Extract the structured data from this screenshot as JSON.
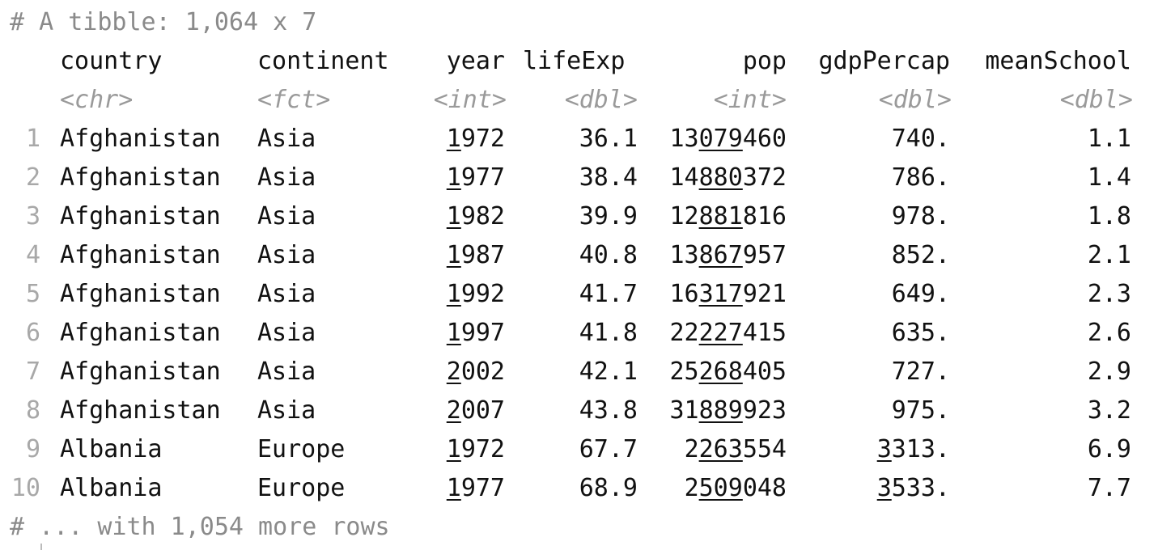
{
  "header_comment": "# A tibble: 1,064 x 7",
  "footer_comment": "# ... with 1,054 more rows",
  "columns": [
    {
      "name": "country",
      "type": "<chr>"
    },
    {
      "name": "continent",
      "type": "<fct>"
    },
    {
      "name": "year",
      "type": "<int>"
    },
    {
      "name": "lifeExp",
      "type": "<dbl>"
    },
    {
      "name": "pop",
      "type": "<int>"
    },
    {
      "name": "gdpPercap",
      "type": "<dbl>"
    },
    {
      "name": "meanSchool",
      "type": "<dbl>"
    }
  ],
  "rows": [
    {
      "idx": "1",
      "country": "Afghanistan",
      "continent": "Asia",
      "year": [
        "1",
        "972"
      ],
      "lifeExp": "36.1",
      "pop": [
        "13",
        "079",
        "460"
      ],
      "gdpPercap": [
        "",
        "740."
      ],
      "meanSchool": "1.1"
    },
    {
      "idx": "2",
      "country": "Afghanistan",
      "continent": "Asia",
      "year": [
        "1",
        "977"
      ],
      "lifeExp": "38.4",
      "pop": [
        "14",
        "880",
        "372"
      ],
      "gdpPercap": [
        "",
        "786."
      ],
      "meanSchool": "1.4"
    },
    {
      "idx": "3",
      "country": "Afghanistan",
      "continent": "Asia",
      "year": [
        "1",
        "982"
      ],
      "lifeExp": "39.9",
      "pop": [
        "12",
        "881",
        "816"
      ],
      "gdpPercap": [
        "",
        "978."
      ],
      "meanSchool": "1.8"
    },
    {
      "idx": "4",
      "country": "Afghanistan",
      "continent": "Asia",
      "year": [
        "1",
        "987"
      ],
      "lifeExp": "40.8",
      "pop": [
        "13",
        "867",
        "957"
      ],
      "gdpPercap": [
        "",
        "852."
      ],
      "meanSchool": "2.1"
    },
    {
      "idx": "5",
      "country": "Afghanistan",
      "continent": "Asia",
      "year": [
        "1",
        "992"
      ],
      "lifeExp": "41.7",
      "pop": [
        "16",
        "317",
        "921"
      ],
      "gdpPercap": [
        "",
        "649."
      ],
      "meanSchool": "2.3"
    },
    {
      "idx": "6",
      "country": "Afghanistan",
      "continent": "Asia",
      "year": [
        "1",
        "997"
      ],
      "lifeExp": "41.8",
      "pop": [
        "22",
        "227",
        "415"
      ],
      "gdpPercap": [
        "",
        "635."
      ],
      "meanSchool": "2.6"
    },
    {
      "idx": "7",
      "country": "Afghanistan",
      "continent": "Asia",
      "year": [
        "2",
        "002"
      ],
      "lifeExp": "42.1",
      "pop": [
        "25",
        "268",
        "405"
      ],
      "gdpPercap": [
        "",
        "727."
      ],
      "meanSchool": "2.9"
    },
    {
      "idx": "8",
      "country": "Afghanistan",
      "continent": "Asia",
      "year": [
        "2",
        "007"
      ],
      "lifeExp": "43.8",
      "pop": [
        "31",
        "889",
        "923"
      ],
      "gdpPercap": [
        "",
        "975."
      ],
      "meanSchool": "3.2"
    },
    {
      "idx": "9",
      "country": "Albania",
      "continent": "Europe",
      "year": [
        "1",
        "972"
      ],
      "lifeExp": "67.7",
      "pop": [
        "2",
        "263",
        "554"
      ],
      "gdpPercap": [
        "3",
        "313."
      ],
      "meanSchool": "6.9"
    },
    {
      "idx": "10",
      "country": "Albania",
      "continent": "Europe",
      "year": [
        "1",
        "977"
      ],
      "lifeExp": "68.9",
      "pop": [
        "2",
        "509",
        "048"
      ],
      "gdpPercap": [
        "3",
        "533."
      ],
      "meanSchool": "7.7"
    }
  ]
}
